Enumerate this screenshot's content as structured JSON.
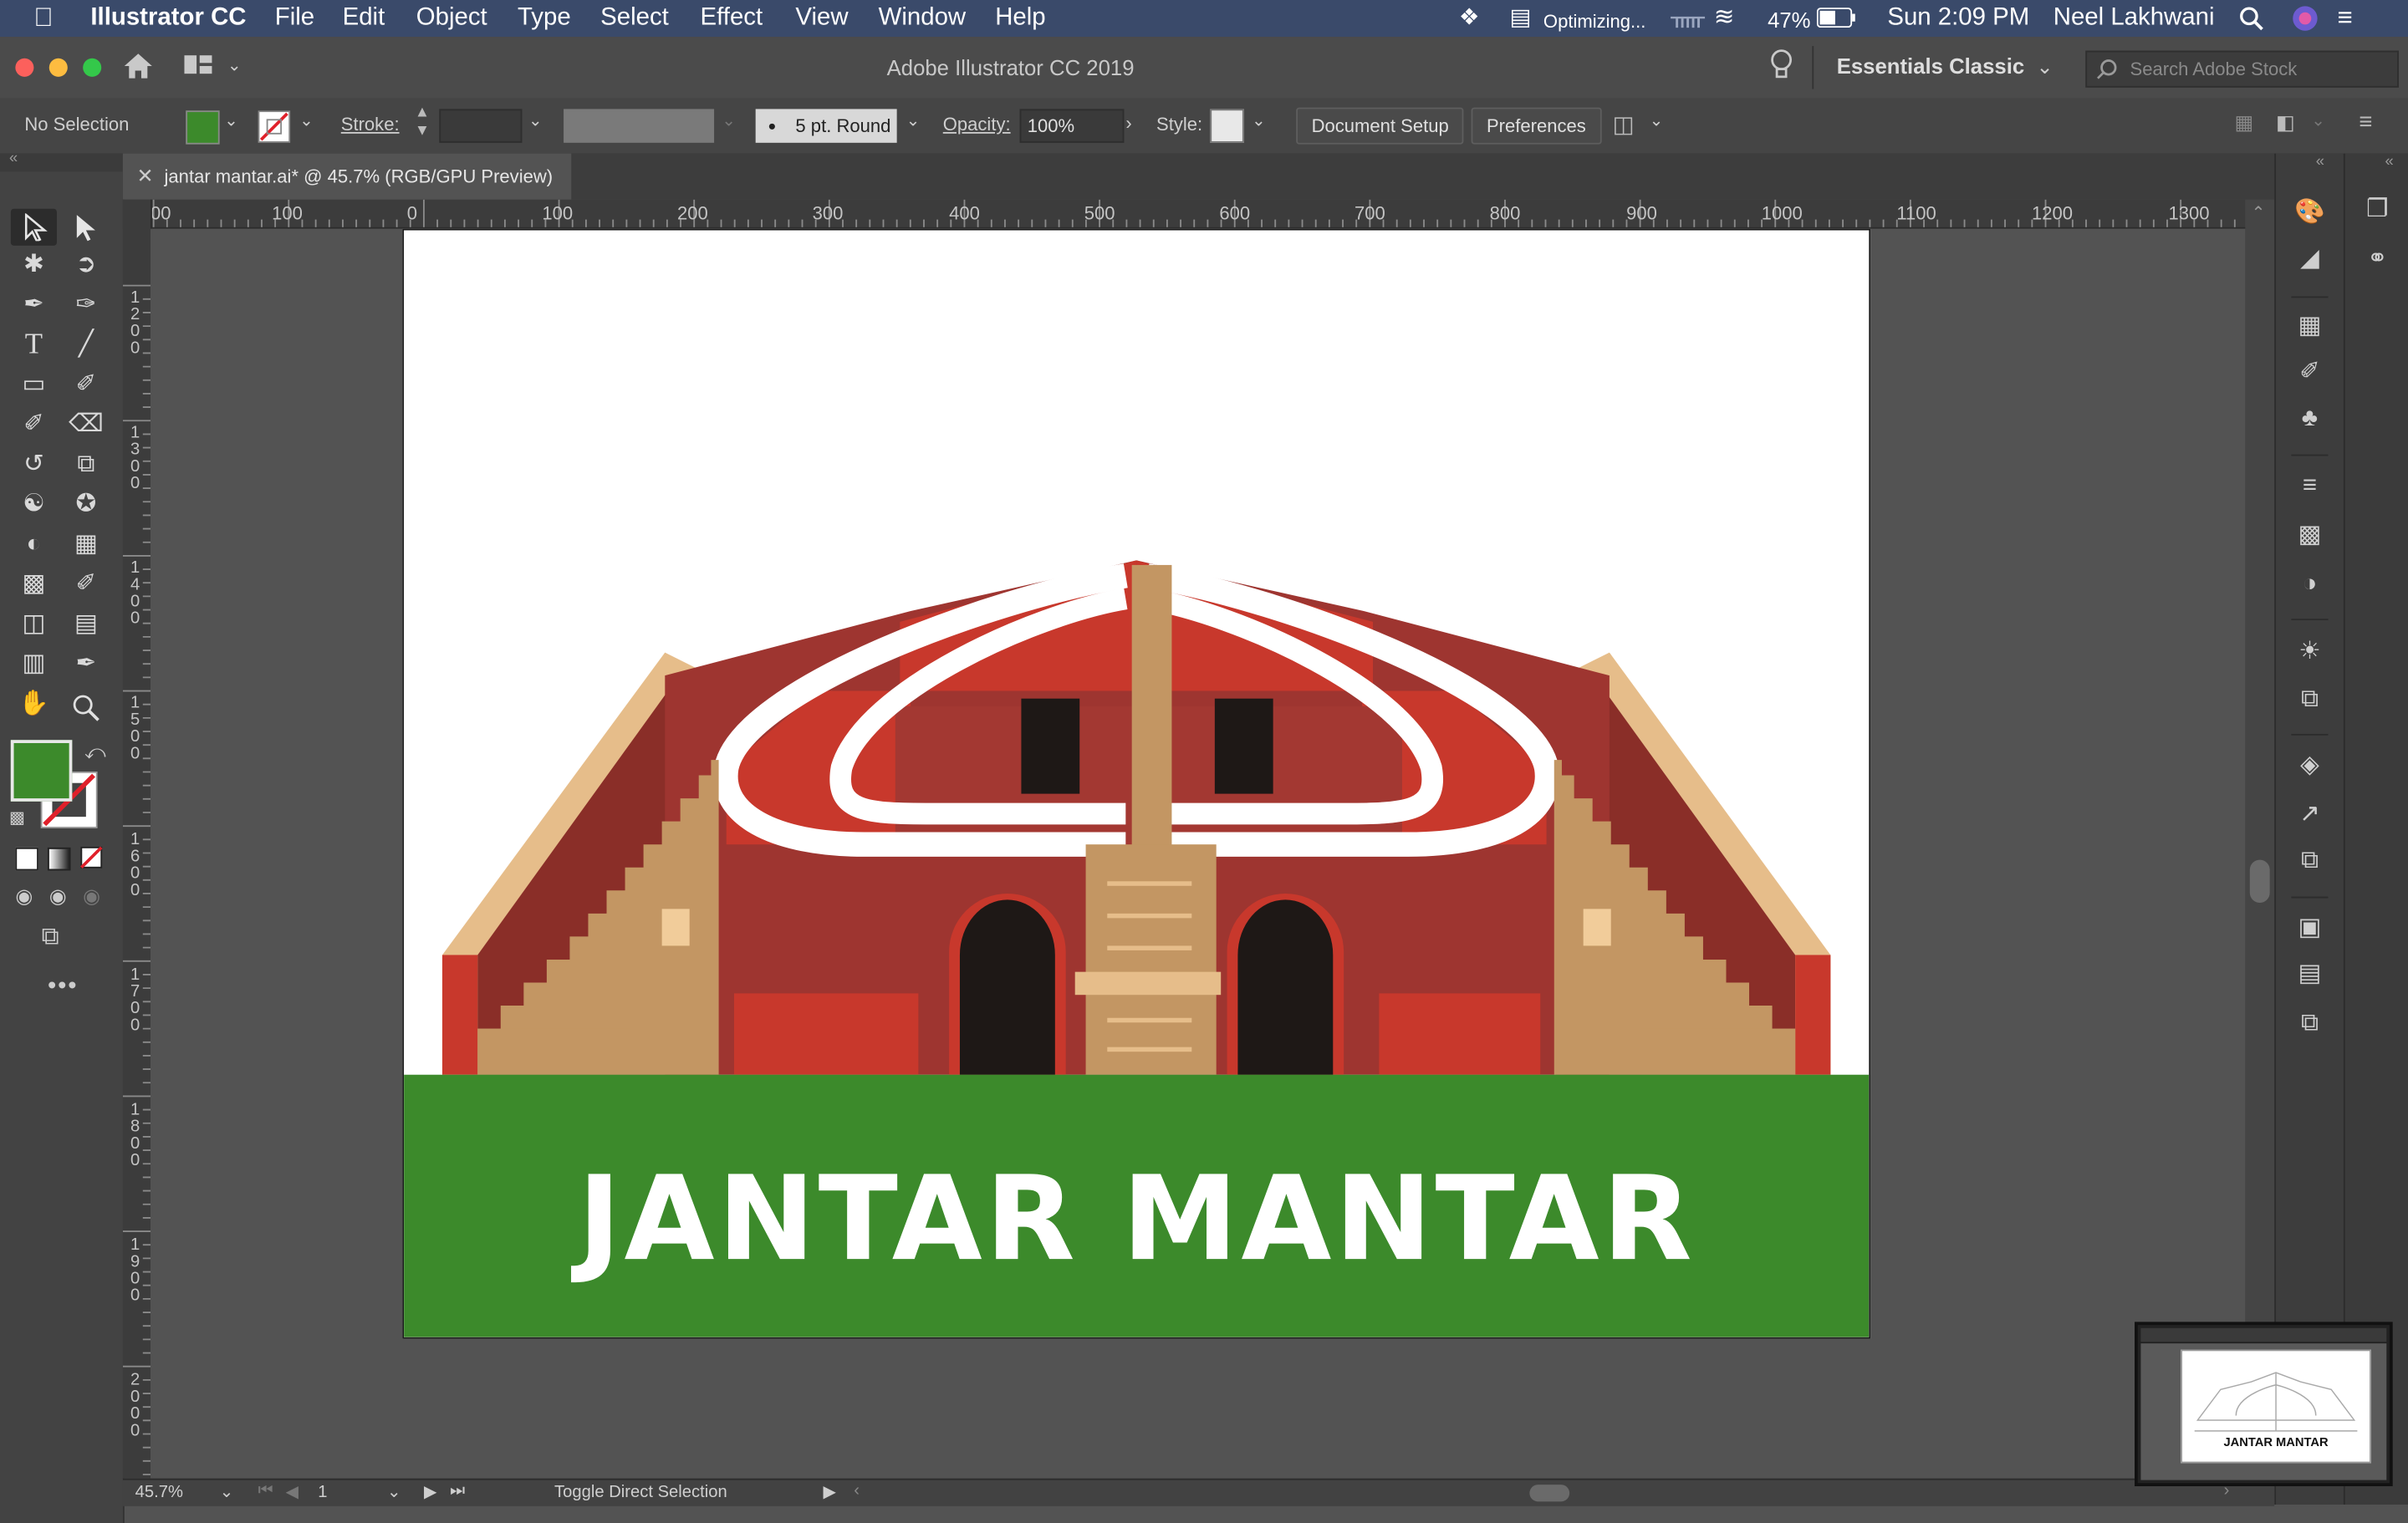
{
  "menubar": {
    "app_name": "Illustrator CC",
    "items": [
      "File",
      "Edit",
      "Object",
      "Type",
      "Select",
      "Effect",
      "View",
      "Window",
      "Help"
    ],
    "status_optimizing": "Optimizing...",
    "battery": "47%",
    "clock": "Sun 2:09 PM",
    "user": "Neel Lakhwani"
  },
  "titlebar": {
    "title": "Adobe Illustrator CC 2019",
    "workspace": "Essentials Classic",
    "search_placeholder": "Search Adobe Stock"
  },
  "control_bar": {
    "selection_status": "No Selection",
    "stroke_label": "Stroke:",
    "brush_label": "5 pt. Round",
    "opacity_label": "Opacity:",
    "opacity_value": "100%",
    "style_label": "Style:",
    "document_setup": "Document Setup",
    "preferences": "Preferences",
    "fill_color": "#3c8a2b"
  },
  "document": {
    "tab_label": "jantar mantar.ai* @ 45.7% (RGB/GPU Preview)",
    "artwork_title": "JANTAR MANTAR",
    "banner_color": "#3c8a2b"
  },
  "rulers": {
    "horizontal": [
      "00",
      "100",
      "0",
      "100",
      "200",
      "300",
      "400",
      "500",
      "600",
      "700",
      "800",
      "900",
      "1000",
      "1100",
      "1200",
      "1300"
    ],
    "vertical": [
      "1200",
      "1300",
      "1400",
      "1500",
      "1600",
      "1700",
      "1800",
      "1900",
      "2000"
    ]
  },
  "status_bar": {
    "zoom": "45.7%",
    "artboard_number": "1",
    "status_text": "Toggle Direct Selection"
  },
  "navigator": {
    "thumbnail_title": "JANTAR MANTAR"
  }
}
